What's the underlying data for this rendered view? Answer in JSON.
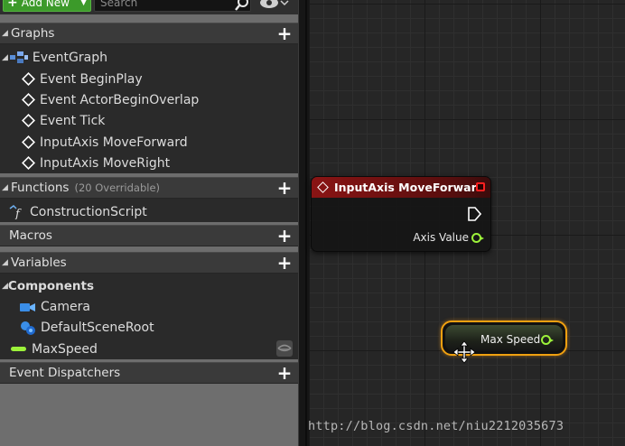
{
  "toolbar": {
    "add_new_label": "Add New",
    "search_placeholder": "Search"
  },
  "sections": {
    "graphs": "Graphs",
    "functions": "Functions",
    "functions_sub": "(20 Overridable)",
    "macros": "Macros",
    "variables": "Variables",
    "event_dispatchers": "Event Dispatchers"
  },
  "graphs": {
    "event_graph": "EventGraph",
    "items": [
      "Event BeginPlay",
      "Event ActorBeginOverlap",
      "Event Tick",
      "InputAxis MoveForward",
      "InputAxis MoveRight"
    ]
  },
  "functions": {
    "items": [
      "ConstructionScript"
    ]
  },
  "variables": {
    "components_label": "Components",
    "components": [
      "Camera",
      "DefaultSceneRoot"
    ],
    "items": [
      "MaxSpeed"
    ]
  },
  "graph_nodes": {
    "event_node_title": "InputAxis MoveForward",
    "event_node_output": "Axis Value",
    "variable_node_label": "Max Speed"
  },
  "colors": {
    "add_new": "#3c9a2a",
    "event_header": "#8a1414",
    "float_pin": "#9cf23a",
    "selection": "#f0a010"
  },
  "watermark": "http://blog.csdn.net/niu2212035673"
}
